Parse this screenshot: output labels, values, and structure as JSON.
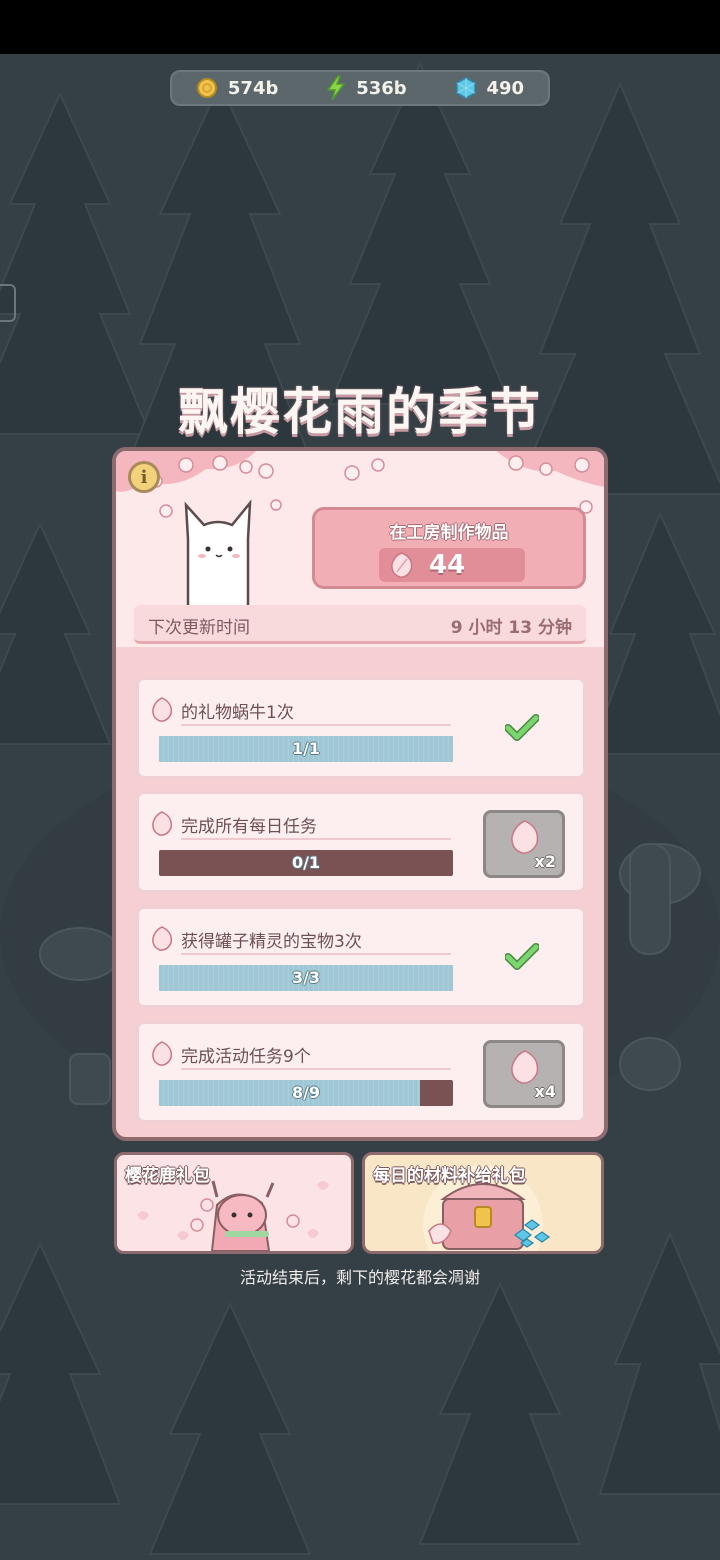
{
  "resources": [
    {
      "icon": "coin-icon",
      "value": "574b"
    },
    {
      "icon": "lightning-icon",
      "value": "536b"
    },
    {
      "icon": "gem-icon",
      "value": "490"
    }
  ],
  "event": {
    "title": "飘樱花雨的季节",
    "craft_label": "在工房制作物品",
    "craft_count": "44",
    "update_label": "下次更新时间",
    "update_time": "9 小时 13 分钟"
  },
  "tasks": [
    {
      "label": "的礼物蜗牛1次",
      "progress_text": "1/1",
      "progress": 1.0,
      "status": "complete"
    },
    {
      "label": "完成所有每日任务",
      "progress_text": "0/1",
      "progress": 0.0,
      "status": "reward",
      "reward": "x2"
    },
    {
      "label": "获得罐子精灵的宝物3次",
      "progress_text": "3/3",
      "progress": 1.0,
      "status": "complete"
    },
    {
      "label": "完成活动任务9个",
      "progress_text": "8/9",
      "progress": 0.889,
      "status": "reward",
      "reward": "x4"
    }
  ],
  "packs": {
    "deer_title": "樱花鹿礼包",
    "supply_title": "每日的材料补给礼包"
  },
  "footnote": "活动结束后，剩下的樱花都会凋谢",
  "colors": {
    "panel_bg": "#f6cfd3",
    "panel_border": "#8c6a6e",
    "bar_fill": "#9fc7d4",
    "bar_empty": "#7a5254",
    "check_green": "#6cc06a"
  }
}
